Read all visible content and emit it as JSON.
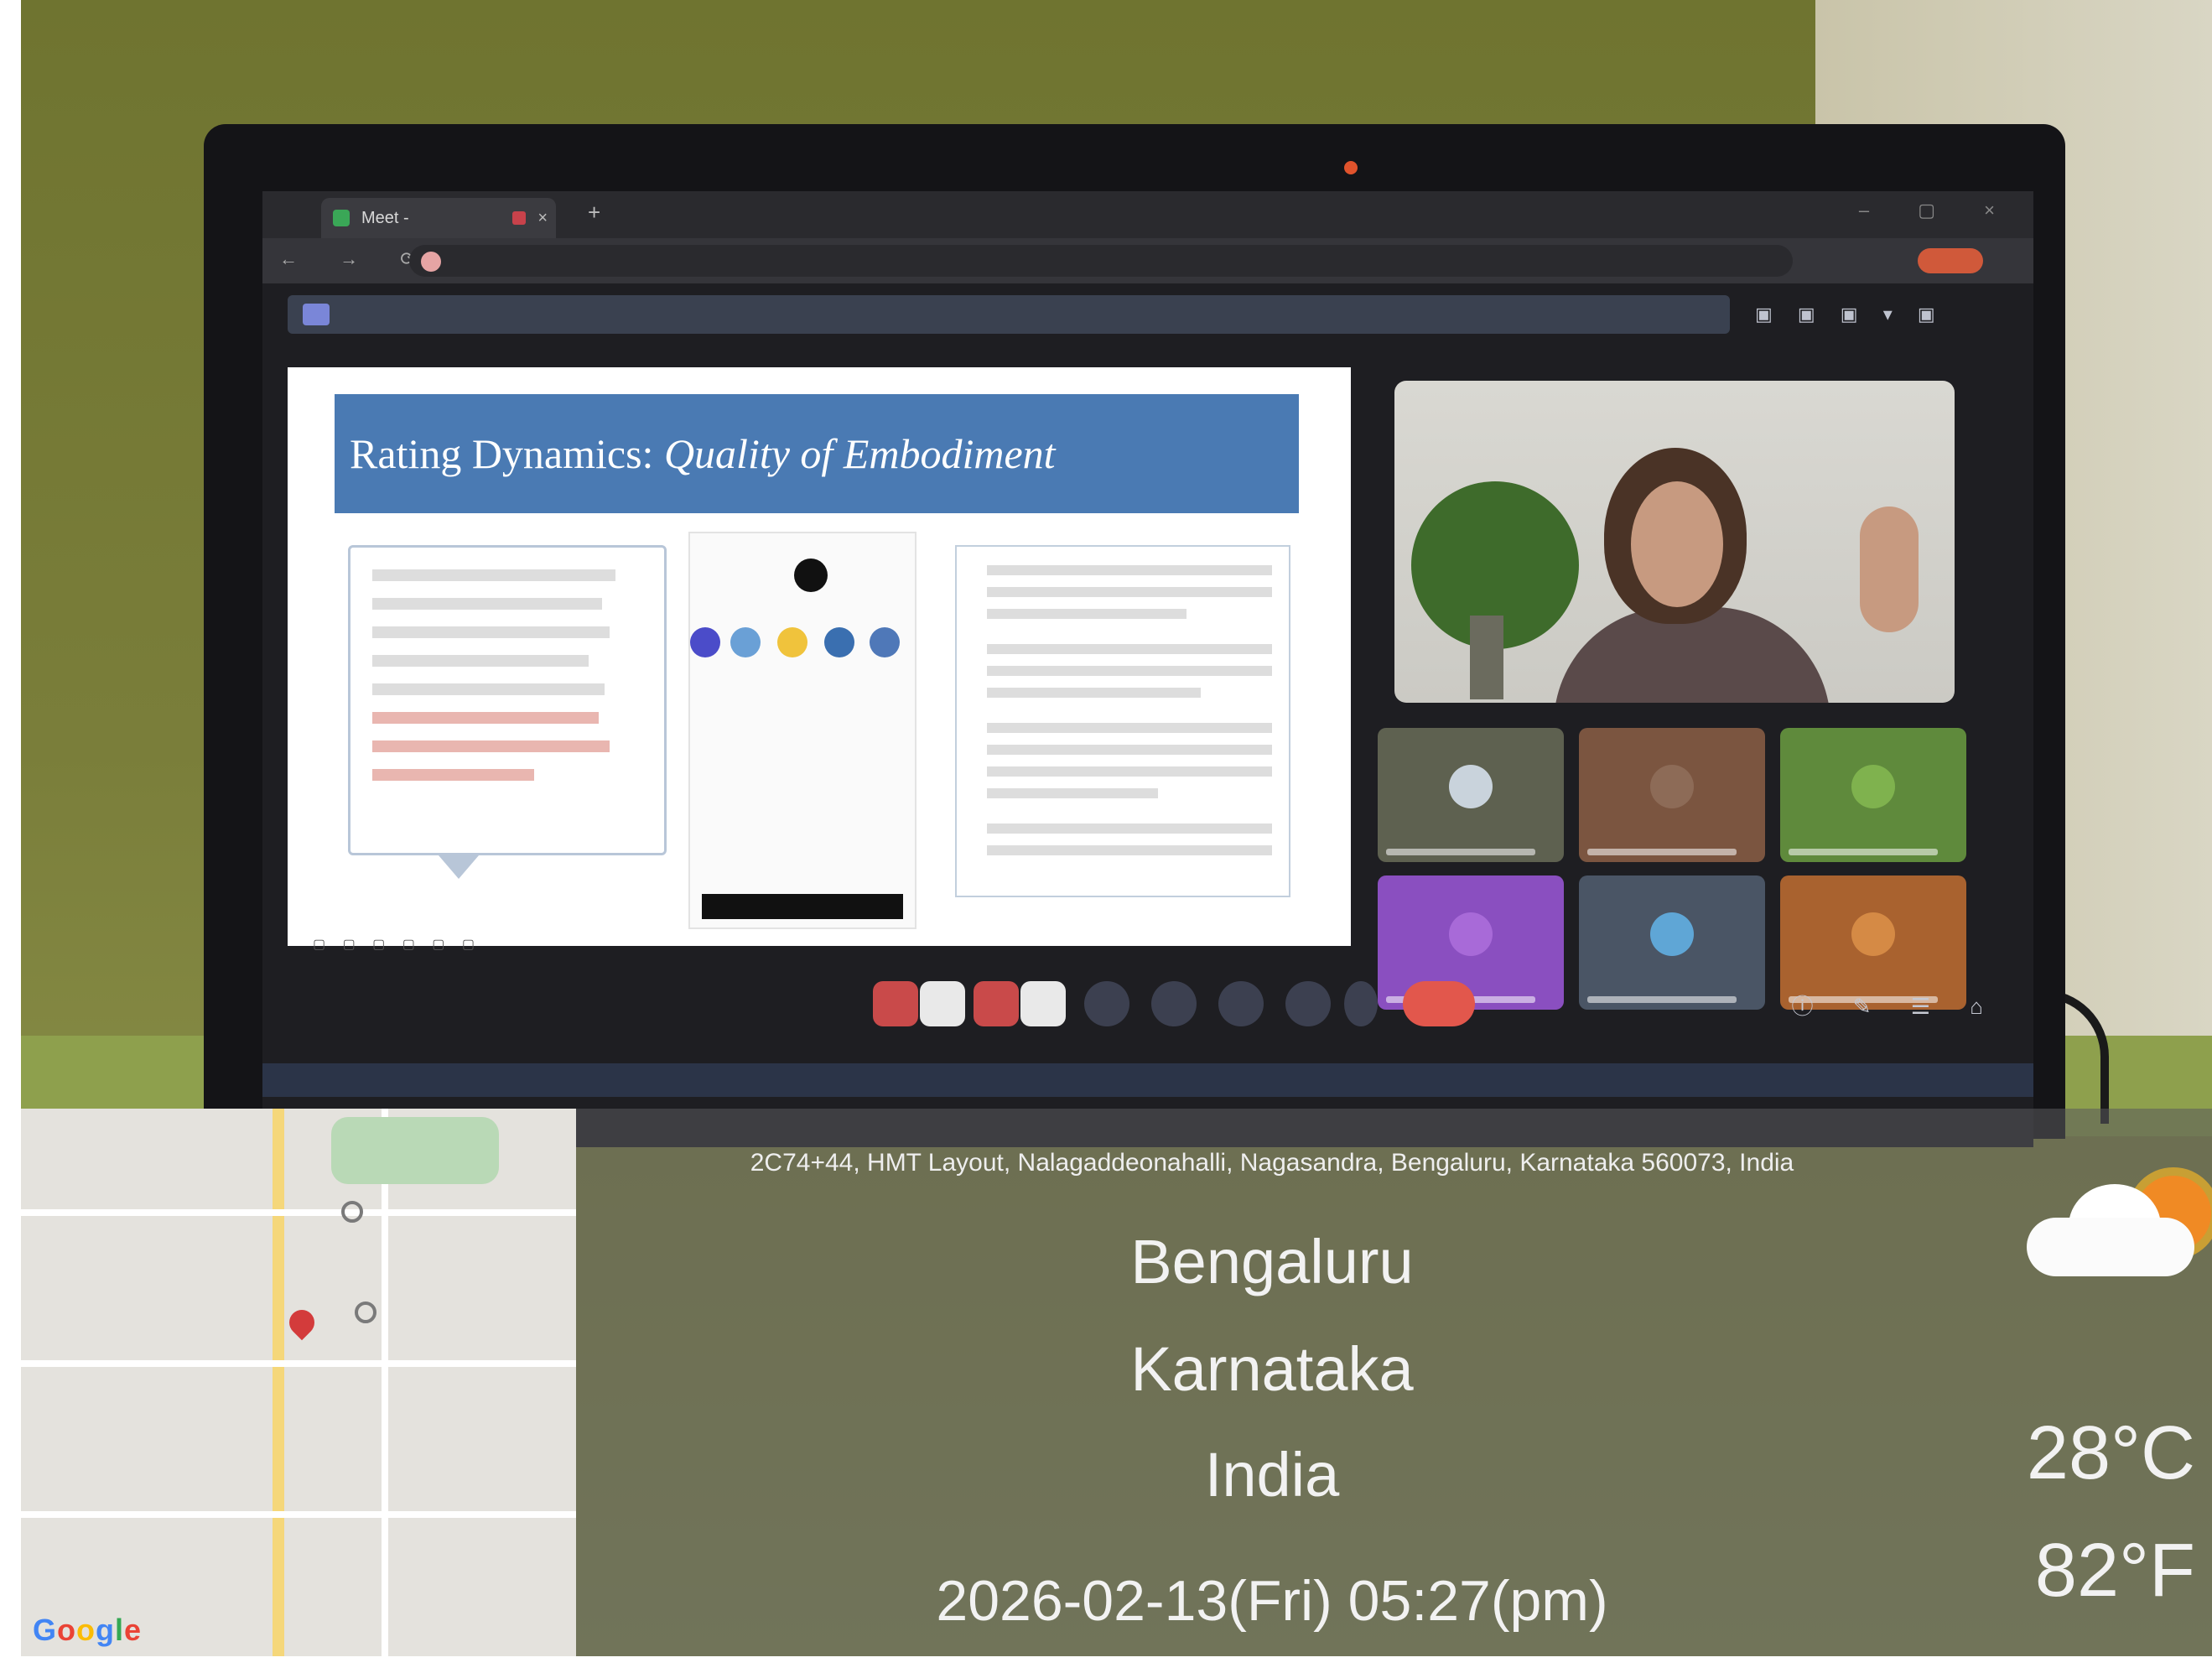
{
  "browser": {
    "tab_label": "Meet - ",
    "tab_close": "×",
    "new_tab": "+",
    "window_controls": "– ▢ ×",
    "nav": "← → ⟳",
    "url": "",
    "profile_label": ""
  },
  "meet": {
    "presenting_banner": "",
    "meeting_title": ""
  },
  "slide": {
    "title_plain": "Rating Dynamics: ",
    "title_italic": "Quality of Embodiment",
    "quote": "",
    "citation": ""
  },
  "overlay": {
    "address": "2C74+44, HMT Layout, Nalagaddeonahalli, Nagasandra, Bengaluru, Karnataka 560073, India",
    "city": "Bengaluru",
    "state": "Karnataka",
    "country": "India",
    "datetime": "2026-02-13(Fri)   05:27(pm)",
    "temp_c": "28°C",
    "temp_f": "82°F",
    "weather_icon": "partly-cloudy-icon",
    "map_logo": "Google"
  },
  "colors": {
    "slide_header": "#4a7ab3",
    "leave_button": "#e2574c",
    "map_pin": "#d33b3b"
  }
}
